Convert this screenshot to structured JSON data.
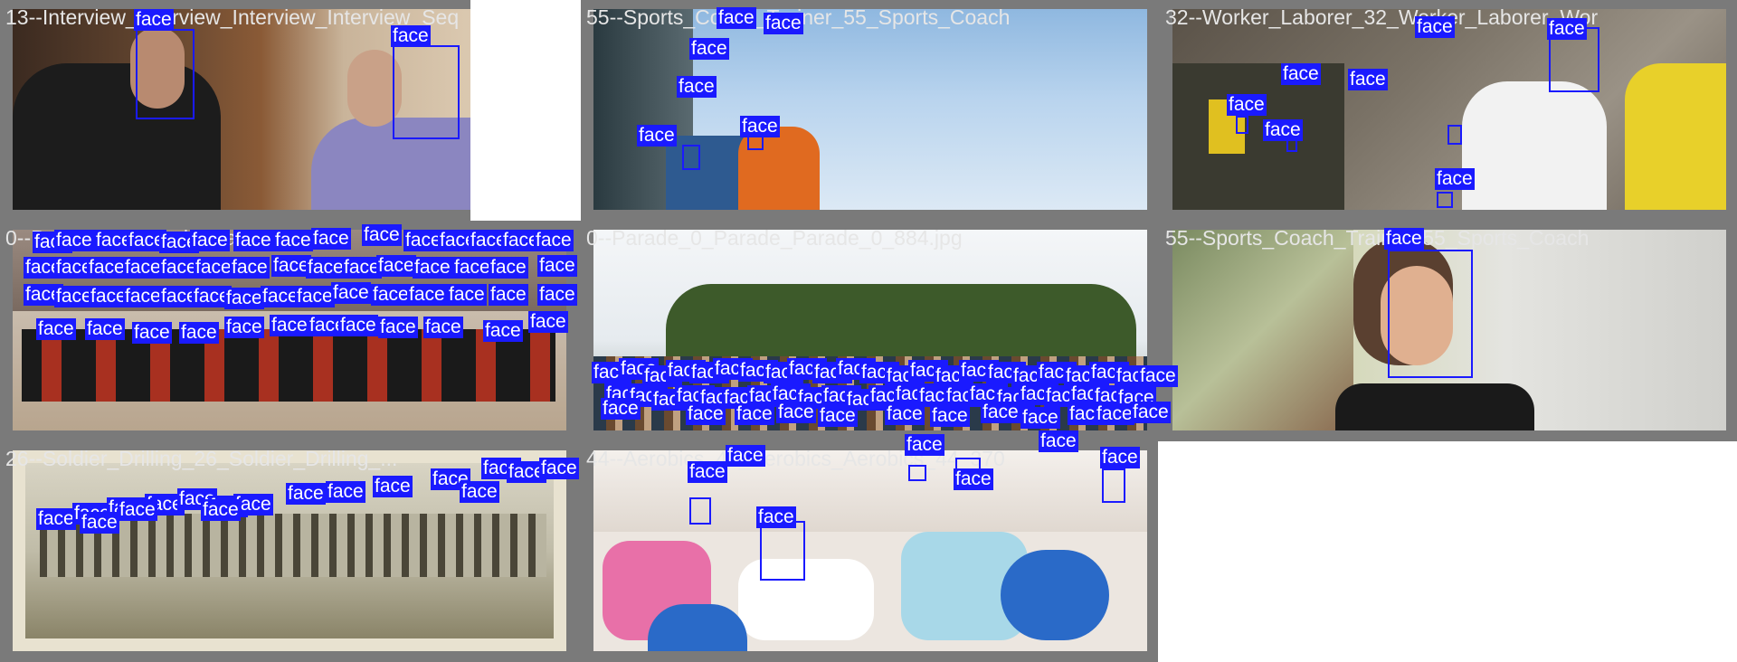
{
  "colors": {
    "box": "#1a1aff",
    "label_text": "#ffffff",
    "title_text": "#e6e6e6",
    "tile_bg": "#7a7a7a"
  },
  "box_label": "face",
  "tiles": [
    {
      "title": "13--Interview_Interview_Interview_Interview_Seq"
    },
    {
      "title": "55--Sports_Coach_Trainer_55_Sports_Coach"
    },
    {
      "title": "32--Worker_Laborer_32_Worker_Laborer_Wor"
    },
    {
      "title": "0--Parade_0_Parade_Parade_0_..."
    },
    {
      "title": "0--Parade_0_Parade_Parade_0_884.jpg"
    },
    {
      "title": "55--Sports_Coach_Trainer_55_Sports_Coach"
    },
    {
      "title": "26--Soldier_Drilling_26_Soldier_Drilling_..."
    },
    {
      "title": "44--Aerobics_44_Aerobics_Aerobics_44_370"
    }
  ]
}
